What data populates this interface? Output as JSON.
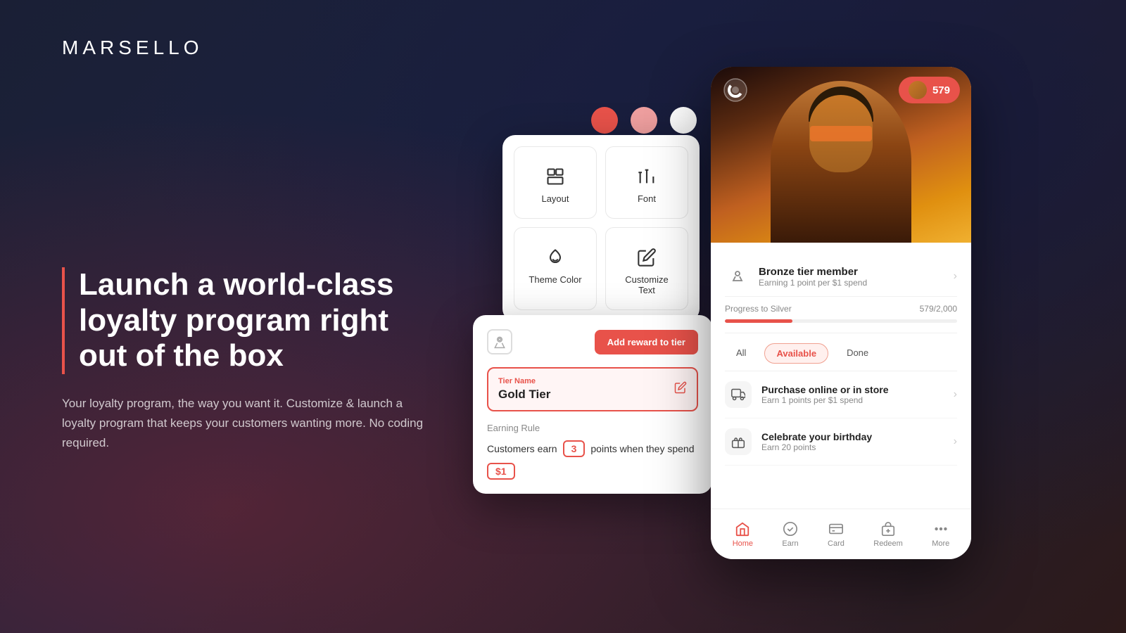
{
  "brand": {
    "name": "MARSELLO"
  },
  "hero": {
    "headline": "Launch a world-class loyalty program right out of the box",
    "subtext": "Your loyalty program, the way you want it. Customize & launch a loyalty program that keeps your customers wanting more. No coding required."
  },
  "color_dots": [
    {
      "color": "#e8524a",
      "label": "red"
    },
    {
      "color": "#f0a0a0",
      "label": "pink"
    },
    {
      "color": "#ffffff",
      "label": "white"
    }
  ],
  "customize_panel": {
    "options": [
      {
        "id": "layout",
        "label": "Layout"
      },
      {
        "id": "font",
        "label": "Font"
      },
      {
        "id": "theme_color",
        "label": "Theme Color"
      },
      {
        "id": "customize_text",
        "label": "Customize Text"
      }
    ]
  },
  "tier_panel": {
    "add_reward_btn": "Add reward to tier",
    "tier_name_label": "Tier Name",
    "tier_name_value": "Gold Tier",
    "earning_rule_label": "Earning Rule",
    "earning_rule_text_before": "Customers earn",
    "earning_rule_points": "3",
    "earning_rule_text_mid": "points when they spend",
    "earning_rule_amount": "$1"
  },
  "mobile_app": {
    "points_badge": "579",
    "tier_member": {
      "title": "Bronze tier member",
      "subtitle": "Earning 1 point per $1 spend"
    },
    "progress": {
      "label": "Progress to Silver",
      "current": "579/2,000",
      "percent": 29
    },
    "filter_tabs": [
      "All",
      "Available",
      "Done"
    ],
    "active_tab": "Available",
    "rewards": [
      {
        "icon": "🛍️",
        "title": "Purchase online or in store",
        "subtitle": "Earn 1 points per $1 spend"
      },
      {
        "icon": "🎁",
        "title": "Celebrate your birthday",
        "subtitle": "Earn 20 points"
      }
    ],
    "nav_items": [
      {
        "label": "Home",
        "icon": "home",
        "active": true
      },
      {
        "label": "Earn",
        "icon": "earn",
        "active": false
      },
      {
        "label": "Card",
        "icon": "card",
        "active": false
      },
      {
        "label": "Redeem",
        "icon": "redeem",
        "active": false
      },
      {
        "label": "More",
        "icon": "more",
        "active": false
      }
    ]
  }
}
